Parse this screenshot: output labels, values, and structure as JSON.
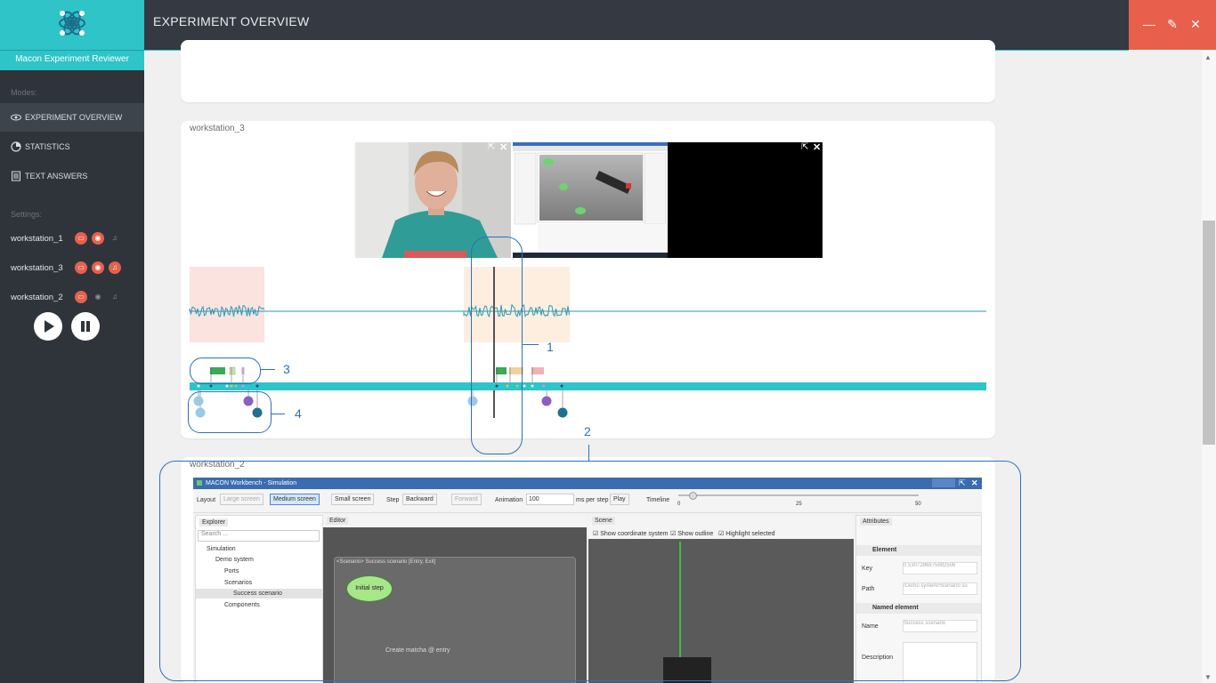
{
  "app": {
    "name": "Macon Experiment Reviewer",
    "page_title": "EXPERIMENT OVERVIEW"
  },
  "sidebar": {
    "modes_label": "Modes:",
    "modes": [
      {
        "label": "EXPERIMENT OVERVIEW",
        "icon": "eye-icon",
        "active": true
      },
      {
        "label": "STATISTICS",
        "icon": "pie-chart-icon",
        "active": false
      },
      {
        "label": "TEXT ANSWERS",
        "icon": "document-icon",
        "active": false
      }
    ],
    "settings_label": "Settings:",
    "workstations": [
      {
        "name": "workstation_1",
        "screen": true,
        "webcam": true,
        "audio": false
      },
      {
        "name": "workstation_3",
        "screen": true,
        "webcam": true,
        "audio": true
      },
      {
        "name": "workstation_2",
        "screen": true,
        "webcam": false,
        "audio": false
      }
    ],
    "play_icon": "play-icon",
    "pause_icon": "pause-icon"
  },
  "window_controls": [
    "minimize-icon",
    "popout-icon",
    "close-icon"
  ],
  "panels": {
    "ws3_label": "workstation_3",
    "ws2_label": "workstation_2"
  },
  "annotations": [
    "1",
    "2",
    "3",
    "4"
  ],
  "simulation_window": {
    "title": "MACON Workbench - Simulation",
    "layout_label": "Layout",
    "large_screen": "Large screen",
    "medium_screen": "Medium screen",
    "small_screen": "Small screen",
    "step_label": "Step",
    "backward": "Backward",
    "forward": "Forward",
    "animation_label": "Animation",
    "animation_value": "100",
    "ms_per_step": "ms per step",
    "play": "Play",
    "timeline_label": "Timeline",
    "timeline_ticks": [
      "0",
      "25",
      "50"
    ],
    "explorer_tab": "Explorer",
    "search_placeholder": "Search ...",
    "tree": [
      "Simulation",
      "Demo system",
      "Ports",
      "Scenarios",
      "Success scenario",
      "Components"
    ],
    "editor_tab": "Editor",
    "scenario_header": "<Scenario> Success scenario [Entry, Exit]",
    "initial_step": "Initial step",
    "transition_label": "Create matcha @ entry",
    "scene_tab": "Scene",
    "show_coordinate_system": "Show coordinate system",
    "show_outline": "Show outline",
    "highlight_selected": "Highlight selected",
    "attributes_tab": "Attributes",
    "element_section": "Element",
    "key_label": "Key",
    "key_value": "0.5307286875982506",
    "path_label": "Path",
    "path_value": "/Demo system/Scenario su",
    "named_element_section": "Named element",
    "name_label": "Name",
    "name_value": "Success scenario",
    "description_label": "Description"
  },
  "colors": {
    "accent": "#2ec4c8",
    "close_red": "#e8604c",
    "sidebar": "#2f343b",
    "header": "#353a42",
    "annotation_blue": "#2a72b8"
  }
}
